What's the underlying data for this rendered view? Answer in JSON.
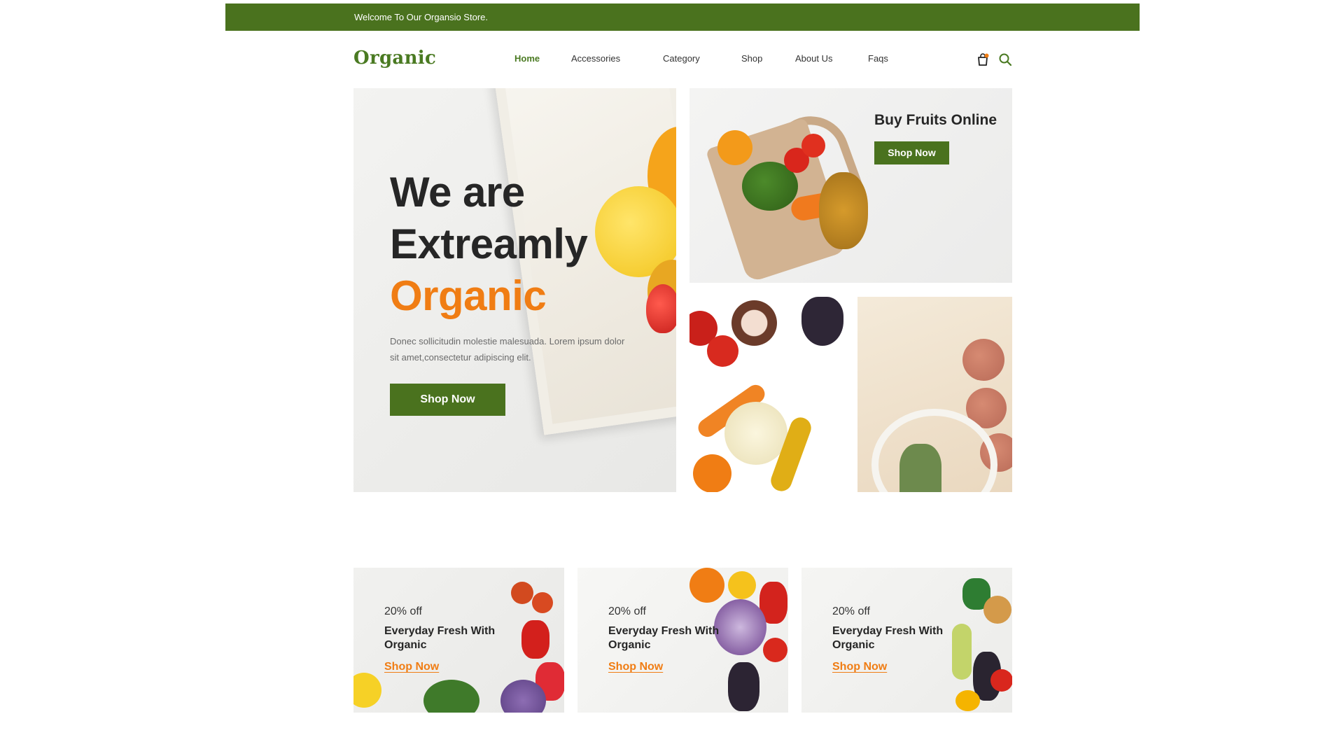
{
  "topbar": {
    "welcome": "Welcome To Our Organsio Store."
  },
  "header": {
    "logo": "Organic",
    "nav": [
      "Home",
      "Accessories",
      "Category",
      "Shop",
      "About Us",
      "Faqs"
    ],
    "active_nav": "Home",
    "icons": [
      "cart-icon",
      "search-icon"
    ]
  },
  "hero": {
    "title_line1": "We are",
    "title_line2": "Extreamly",
    "title_line3": "Organic",
    "description": "Donec sollicitudin molestie malesuada. Lorem ipsum dolor sit amet,consectetur adipiscing elit.",
    "button": "Shop Now"
  },
  "fruits_card": {
    "title": "Buy Fruits Online",
    "button": "Shop Now"
  },
  "promos": [
    {
      "discount": "20% off",
      "title": "Everyday Fresh With Organic",
      "link": "Shop Now"
    },
    {
      "discount": "20% off",
      "title": "Everyday Fresh With Organic",
      "link": "Shop Now"
    },
    {
      "discount": "20% off",
      "title": "Everyday Fresh With Organic",
      "link": "Shop Now"
    }
  ],
  "colors": {
    "brand_green": "#4a721e",
    "accent_orange": "#f07d14",
    "text_dark": "#262626"
  }
}
